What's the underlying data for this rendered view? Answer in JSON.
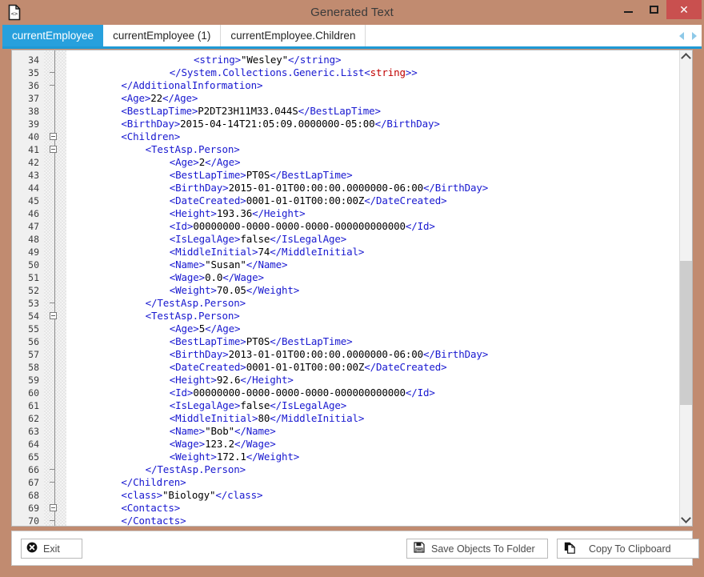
{
  "window": {
    "title": "Generated Text",
    "icon": "code-document-icon",
    "controls": {
      "minimize": "minimize-icon",
      "maximize": "maximize-icon",
      "close": "close-icon"
    },
    "frame_color": "#c18b70",
    "close_button_color": "#c9504f"
  },
  "tabs": {
    "items": [
      {
        "label": "currentEmployee",
        "active": true
      },
      {
        "label": "currentEmployee (1)",
        "active": false
      },
      {
        "label": "currentEmployee.Children",
        "active": false
      }
    ],
    "active_color": "#27a0dd",
    "underline_color": "#1e9ad6",
    "nav_prev": "arrow-left-icon",
    "nav_next": "arrow-right-icon"
  },
  "editor": {
    "first_line_number": 34,
    "tag_color": "#1818d0",
    "text_color": "#000000",
    "generic_color": "#c00000",
    "gutter_color": "#f0f0f0",
    "scrollbar": {
      "up": "chevron-up-icon",
      "down": "chevron-down-icon",
      "thumb_top_pct": 44,
      "thumb_height_pct": 32
    },
    "lines": [
      {
        "n": 34,
        "indent": 20,
        "fold": "none",
        "parts": [
          {
            "t": "tg",
            "s": "<string>"
          },
          {
            "t": "tx",
            "s": "\"Wesley\""
          },
          {
            "t": "tg",
            "s": "</string>"
          }
        ]
      },
      {
        "n": 35,
        "indent": 16,
        "fold": "tick",
        "parts": [
          {
            "t": "tg",
            "s": "</System.Collections.Generic.List<"
          },
          {
            "t": "rd",
            "s": "string"
          },
          {
            "t": "tg",
            "s": ">>"
          }
        ]
      },
      {
        "n": 36,
        "indent": 8,
        "fold": "tick",
        "parts": [
          {
            "t": "tg",
            "s": "</AdditionalInformation>"
          }
        ]
      },
      {
        "n": 37,
        "indent": 8,
        "fold": "none",
        "parts": [
          {
            "t": "tg",
            "s": "<Age>"
          },
          {
            "t": "tx",
            "s": "22"
          },
          {
            "t": "tg",
            "s": "</Age>"
          }
        ]
      },
      {
        "n": 38,
        "indent": 8,
        "fold": "none",
        "parts": [
          {
            "t": "tg",
            "s": "<BestLapTime>"
          },
          {
            "t": "tx",
            "s": "P2DT23H11M33.044S"
          },
          {
            "t": "tg",
            "s": "</BestLapTime>"
          }
        ]
      },
      {
        "n": 39,
        "indent": 8,
        "fold": "none",
        "parts": [
          {
            "t": "tg",
            "s": "<BirthDay>"
          },
          {
            "t": "tx",
            "s": "2015-04-14T21:05:09.0000000-05:00"
          },
          {
            "t": "tg",
            "s": "</BirthDay>"
          }
        ]
      },
      {
        "n": 40,
        "indent": 8,
        "fold": "box",
        "parts": [
          {
            "t": "tg",
            "s": "<Children>"
          }
        ]
      },
      {
        "n": 41,
        "indent": 12,
        "fold": "box",
        "parts": [
          {
            "t": "tg",
            "s": "<TestAsp.Person>"
          }
        ]
      },
      {
        "n": 42,
        "indent": 16,
        "fold": "none",
        "parts": [
          {
            "t": "tg",
            "s": "<Age>"
          },
          {
            "t": "tx",
            "s": "2"
          },
          {
            "t": "tg",
            "s": "</Age>"
          }
        ]
      },
      {
        "n": 43,
        "indent": 16,
        "fold": "none",
        "parts": [
          {
            "t": "tg",
            "s": "<BestLapTime>"
          },
          {
            "t": "tx",
            "s": "PT0S"
          },
          {
            "t": "tg",
            "s": "</BestLapTime>"
          }
        ]
      },
      {
        "n": 44,
        "indent": 16,
        "fold": "none",
        "parts": [
          {
            "t": "tg",
            "s": "<BirthDay>"
          },
          {
            "t": "tx",
            "s": "2015-01-01T00:00:00.0000000-06:00"
          },
          {
            "t": "tg",
            "s": "</BirthDay>"
          }
        ]
      },
      {
        "n": 45,
        "indent": 16,
        "fold": "none",
        "parts": [
          {
            "t": "tg",
            "s": "<DateCreated>"
          },
          {
            "t": "tx",
            "s": "0001-01-01T00:00:00Z"
          },
          {
            "t": "tg",
            "s": "</DateCreated>"
          }
        ]
      },
      {
        "n": 46,
        "indent": 16,
        "fold": "none",
        "parts": [
          {
            "t": "tg",
            "s": "<Height>"
          },
          {
            "t": "tx",
            "s": "193.36"
          },
          {
            "t": "tg",
            "s": "</Height>"
          }
        ]
      },
      {
        "n": 47,
        "indent": 16,
        "fold": "none",
        "parts": [
          {
            "t": "tg",
            "s": "<Id>"
          },
          {
            "t": "tx",
            "s": "00000000-0000-0000-0000-000000000000"
          },
          {
            "t": "tg",
            "s": "</Id>"
          }
        ]
      },
      {
        "n": 48,
        "indent": 16,
        "fold": "none",
        "parts": [
          {
            "t": "tg",
            "s": "<IsLegalAge>"
          },
          {
            "t": "tx",
            "s": "false"
          },
          {
            "t": "tg",
            "s": "</IsLegalAge>"
          }
        ]
      },
      {
        "n": 49,
        "indent": 16,
        "fold": "none",
        "parts": [
          {
            "t": "tg",
            "s": "<MiddleInitial>"
          },
          {
            "t": "tx",
            "s": "74"
          },
          {
            "t": "tg",
            "s": "</MiddleInitial>"
          }
        ]
      },
      {
        "n": 50,
        "indent": 16,
        "fold": "none",
        "parts": [
          {
            "t": "tg",
            "s": "<Name>"
          },
          {
            "t": "tx",
            "s": "\"Susan\""
          },
          {
            "t": "tg",
            "s": "</Name>"
          }
        ]
      },
      {
        "n": 51,
        "indent": 16,
        "fold": "none",
        "parts": [
          {
            "t": "tg",
            "s": "<Wage>"
          },
          {
            "t": "tx",
            "s": "0.0"
          },
          {
            "t": "tg",
            "s": "</Wage>"
          }
        ]
      },
      {
        "n": 52,
        "indent": 16,
        "fold": "none",
        "parts": [
          {
            "t": "tg",
            "s": "<Weight>"
          },
          {
            "t": "tx",
            "s": "70.05"
          },
          {
            "t": "tg",
            "s": "</Weight>"
          }
        ]
      },
      {
        "n": 53,
        "indent": 12,
        "fold": "tick",
        "parts": [
          {
            "t": "tg",
            "s": "</TestAsp.Person>"
          }
        ]
      },
      {
        "n": 54,
        "indent": 12,
        "fold": "box",
        "parts": [
          {
            "t": "tg",
            "s": "<TestAsp.Person>"
          }
        ]
      },
      {
        "n": 55,
        "indent": 16,
        "fold": "none",
        "parts": [
          {
            "t": "tg",
            "s": "<Age>"
          },
          {
            "t": "tx",
            "s": "5"
          },
          {
            "t": "tg",
            "s": "</Age>"
          }
        ]
      },
      {
        "n": 56,
        "indent": 16,
        "fold": "none",
        "parts": [
          {
            "t": "tg",
            "s": "<BestLapTime>"
          },
          {
            "t": "tx",
            "s": "PT0S"
          },
          {
            "t": "tg",
            "s": "</BestLapTime>"
          }
        ]
      },
      {
        "n": 57,
        "indent": 16,
        "fold": "none",
        "parts": [
          {
            "t": "tg",
            "s": "<BirthDay>"
          },
          {
            "t": "tx",
            "s": "2013-01-01T00:00:00.0000000-06:00"
          },
          {
            "t": "tg",
            "s": "</BirthDay>"
          }
        ]
      },
      {
        "n": 58,
        "indent": 16,
        "fold": "none",
        "parts": [
          {
            "t": "tg",
            "s": "<DateCreated>"
          },
          {
            "t": "tx",
            "s": "0001-01-01T00:00:00Z"
          },
          {
            "t": "tg",
            "s": "</DateCreated>"
          }
        ]
      },
      {
        "n": 59,
        "indent": 16,
        "fold": "none",
        "parts": [
          {
            "t": "tg",
            "s": "<Height>"
          },
          {
            "t": "tx",
            "s": "92.6"
          },
          {
            "t": "tg",
            "s": "</Height>"
          }
        ]
      },
      {
        "n": 60,
        "indent": 16,
        "fold": "none",
        "parts": [
          {
            "t": "tg",
            "s": "<Id>"
          },
          {
            "t": "tx",
            "s": "00000000-0000-0000-0000-000000000000"
          },
          {
            "t": "tg",
            "s": "</Id>"
          }
        ]
      },
      {
        "n": 61,
        "indent": 16,
        "fold": "none",
        "parts": [
          {
            "t": "tg",
            "s": "<IsLegalAge>"
          },
          {
            "t": "tx",
            "s": "false"
          },
          {
            "t": "tg",
            "s": "</IsLegalAge>"
          }
        ]
      },
      {
        "n": 62,
        "indent": 16,
        "fold": "none",
        "parts": [
          {
            "t": "tg",
            "s": "<MiddleInitial>"
          },
          {
            "t": "tx",
            "s": "80"
          },
          {
            "t": "tg",
            "s": "</MiddleInitial>"
          }
        ]
      },
      {
        "n": 63,
        "indent": 16,
        "fold": "none",
        "parts": [
          {
            "t": "tg",
            "s": "<Name>"
          },
          {
            "t": "tx",
            "s": "\"Bob\""
          },
          {
            "t": "tg",
            "s": "</Name>"
          }
        ]
      },
      {
        "n": 64,
        "indent": 16,
        "fold": "none",
        "parts": [
          {
            "t": "tg",
            "s": "<Wage>"
          },
          {
            "t": "tx",
            "s": "123.2"
          },
          {
            "t": "tg",
            "s": "</Wage>"
          }
        ]
      },
      {
        "n": 65,
        "indent": 16,
        "fold": "none",
        "parts": [
          {
            "t": "tg",
            "s": "<Weight>"
          },
          {
            "t": "tx",
            "s": "172.1"
          },
          {
            "t": "tg",
            "s": "</Weight>"
          }
        ]
      },
      {
        "n": 66,
        "indent": 12,
        "fold": "tick",
        "parts": [
          {
            "t": "tg",
            "s": "</TestAsp.Person>"
          }
        ]
      },
      {
        "n": 67,
        "indent": 8,
        "fold": "tick",
        "parts": [
          {
            "t": "tg",
            "s": "</Children>"
          }
        ]
      },
      {
        "n": 68,
        "indent": 8,
        "fold": "none",
        "parts": [
          {
            "t": "tg",
            "s": "<class>"
          },
          {
            "t": "tx",
            "s": "\"Biology\""
          },
          {
            "t": "tg",
            "s": "</class>"
          }
        ]
      },
      {
        "n": 69,
        "indent": 8,
        "fold": "box",
        "parts": [
          {
            "t": "tg",
            "s": "<Contacts>"
          }
        ]
      },
      {
        "n": 70,
        "indent": 8,
        "fold": "tick",
        "parts": [
          {
            "t": "tg",
            "s": "</Contacts>"
          }
        ]
      }
    ]
  },
  "footer": {
    "exit_label": "Exit",
    "exit_icon": "exit-circle-x-icon",
    "save_label": "Save Objects To Folder",
    "save_icon": "floppy-disk-save-icon",
    "copy_label": "Copy To Clipboard",
    "copy_icon": "copy-pages-icon"
  }
}
